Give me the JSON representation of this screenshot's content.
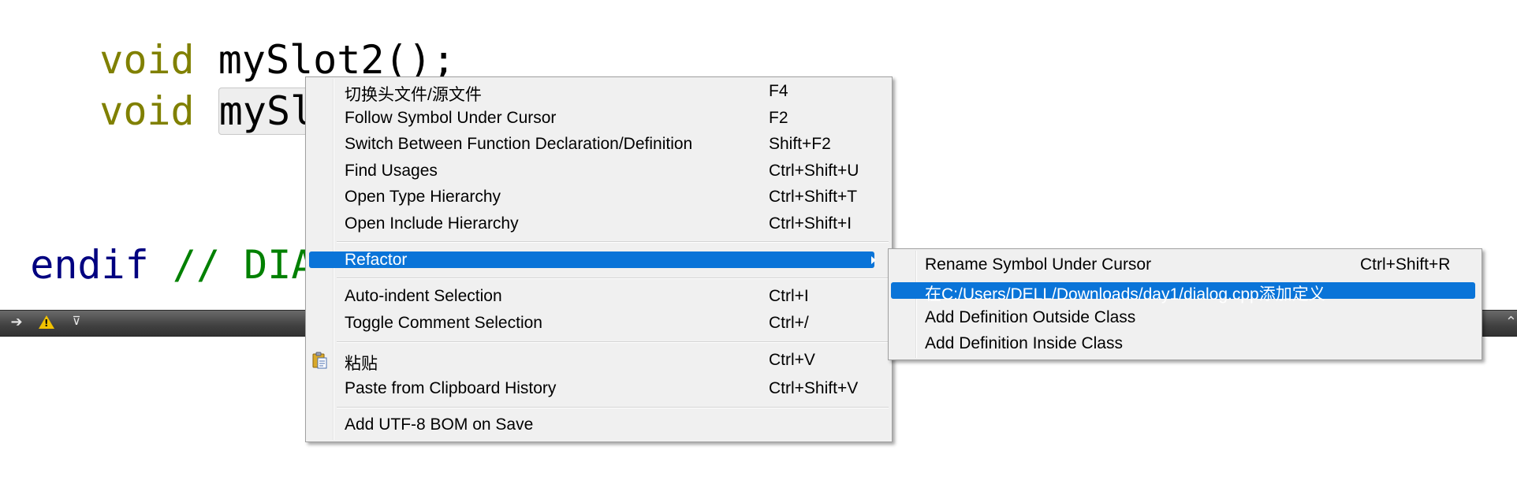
{
  "editor": {
    "line1_kw": "void",
    "line1_fn": "mySlot2();",
    "line2_kw": "void",
    "line2_fn": "mySlot13",
    "line2_rest": "();",
    "line3_pre": "endif",
    "line3_cmt": "// DIALO"
  },
  "context_menu": {
    "items": [
      {
        "label": "切换头文件/源文件",
        "shortcut": "F4"
      },
      {
        "label": "Follow Symbol Under Cursor",
        "shortcut": "F2"
      },
      {
        "label": "Switch Between Function Declaration/Definition",
        "shortcut": "Shift+F2"
      },
      {
        "label": "Find Usages",
        "shortcut": "Ctrl+Shift+U"
      },
      {
        "label": "Open Type Hierarchy",
        "shortcut": "Ctrl+Shift+T"
      },
      {
        "label": "Open Include Hierarchy",
        "shortcut": "Ctrl+Shift+I"
      },
      {
        "label": "Refactor",
        "shortcut": ""
      },
      {
        "label": "Auto-indent Selection",
        "shortcut": "Ctrl+I"
      },
      {
        "label": "Toggle Comment Selection",
        "shortcut": "Ctrl+/"
      },
      {
        "label": "粘贴",
        "shortcut": "Ctrl+V"
      },
      {
        "label": "Paste from Clipboard History",
        "shortcut": "Ctrl+Shift+V"
      },
      {
        "label": "Add UTF-8 BOM on Save",
        "shortcut": ""
      }
    ]
  },
  "refactor_submenu": {
    "items": [
      {
        "label": "Rename Symbol Under Cursor",
        "shortcut": "Ctrl+Shift+R"
      },
      {
        "label": "在C:/Users/DELL/Downloads/day1/dialog.cpp添加定义",
        "shortcut": ""
      },
      {
        "label": "Add Definition Outside Class",
        "shortcut": ""
      },
      {
        "label": "Add Definition Inside Class",
        "shortcut": ""
      }
    ]
  },
  "colors": {
    "highlight": "#0a74d8",
    "keyword": "#808000",
    "preprocessor": "#000080",
    "comment": "#008000"
  }
}
